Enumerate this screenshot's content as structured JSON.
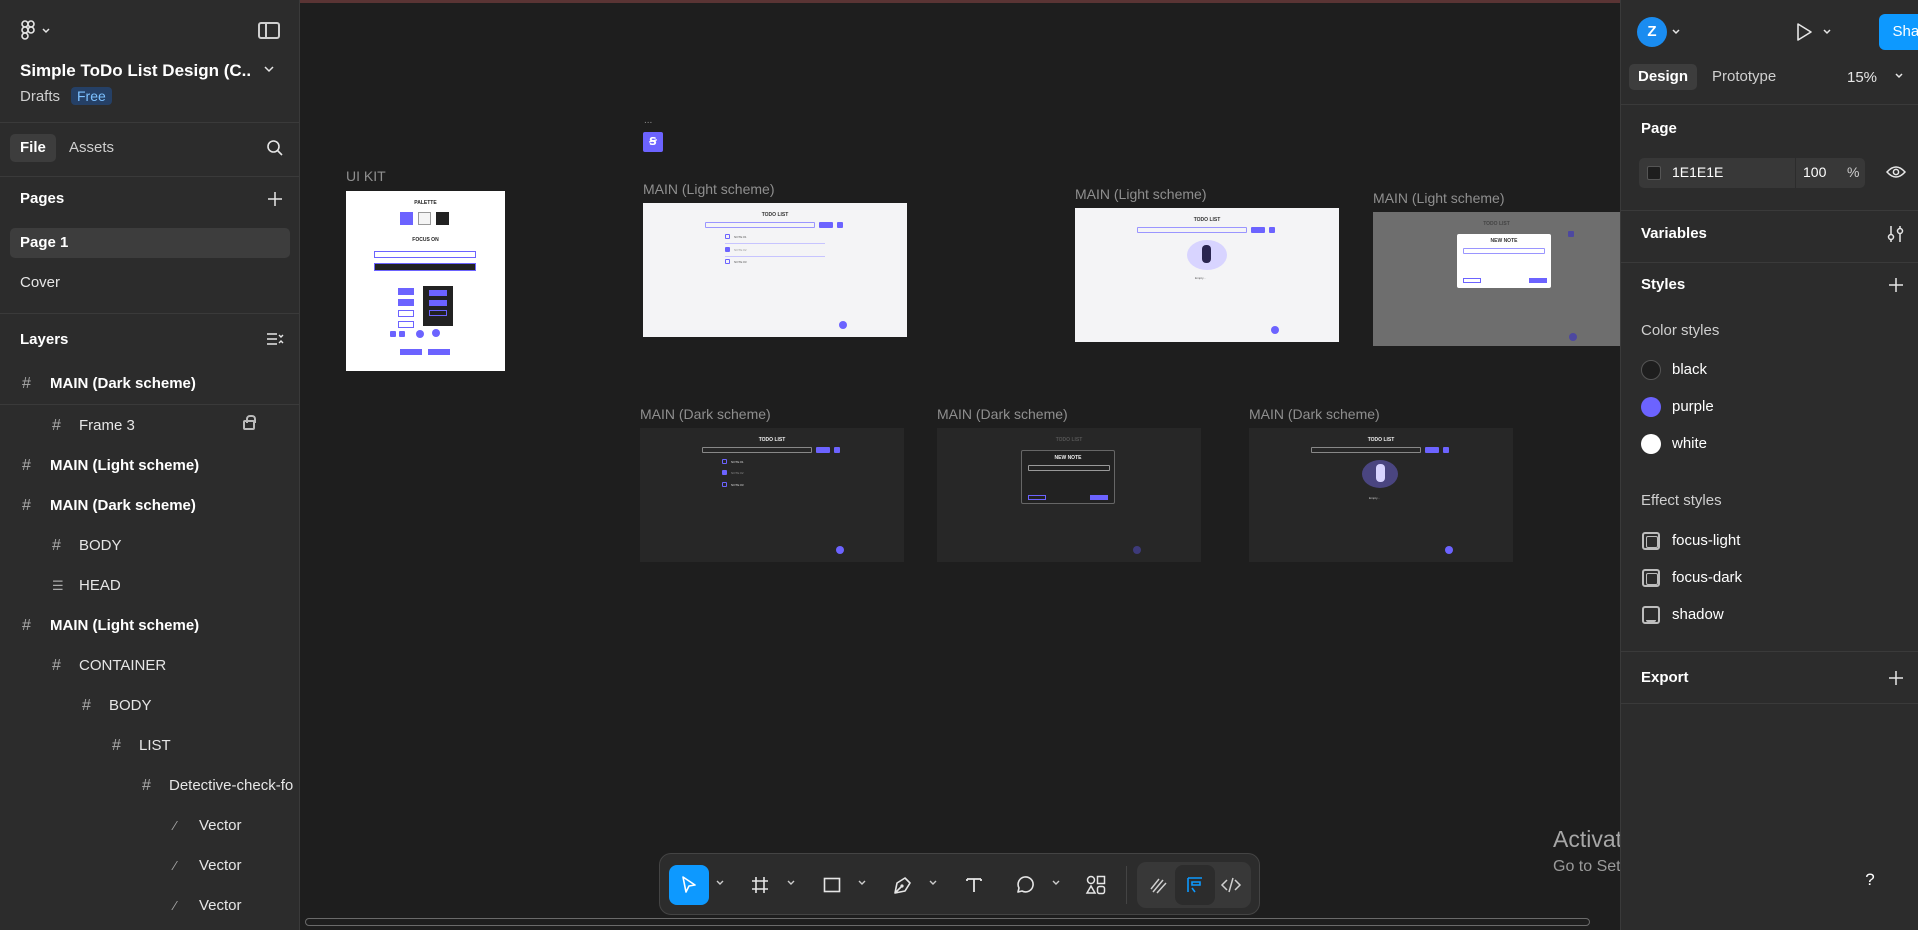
{
  "file": {
    "title": "Simple ToDo List Design (C...",
    "location": "Drafts",
    "plan_badge": "Free"
  },
  "left_tabs": {
    "file": "File",
    "assets": "Assets"
  },
  "pages": {
    "title": "Pages",
    "items": [
      "Page 1",
      "Cover"
    ],
    "active": "Page 1"
  },
  "layers": {
    "title": "Layers",
    "items": [
      "MAIN (Dark scheme)",
      "Frame 3",
      "MAIN (Light scheme)",
      "MAIN (Dark scheme)",
      "BODY",
      "HEAD",
      "MAIN (Light scheme)",
      "CONTAINER",
      "BODY",
      "LIST",
      "Detective-check-fo",
      "Vector",
      "Vector",
      "Vector"
    ]
  },
  "canvas": {
    "frames": [
      "UI KIT",
      "MAIN (Light scheme)",
      "MAIN (Light scheme)",
      "MAIN (Light scheme)",
      "MAIN (Dark scheme)",
      "MAIN (Dark scheme)",
      "MAIN (Dark scheme)"
    ],
    "selection_dots": "...",
    "ui_kit": {
      "palette": "PALETTE",
      "focus_on": "FOCUS ON"
    },
    "todo_title": "TODO LIST",
    "new_note": "NEW NOTE",
    "notes": [
      "NOTE #1",
      "NOTE #2",
      "NOTE #3"
    ],
    "empty_text": "Empty..."
  },
  "right_panel": {
    "avatar_initial": "Z",
    "share": "Share",
    "tabs": {
      "design": "Design",
      "prototype": "Prototype"
    },
    "zoom": "15%",
    "page_section": "Page",
    "page_color": "1E1E1E",
    "page_opacity": "100",
    "percent": "%",
    "variables": "Variables",
    "styles": "Styles",
    "color_styles_title": "Color styles",
    "color_styles": [
      {
        "name": "black",
        "color": "#1e1e1e"
      },
      {
        "name": "purple",
        "color": "#6c63ff"
      },
      {
        "name": "white",
        "color": "#ffffff"
      }
    ],
    "effect_styles_title": "Effect styles",
    "effect_styles": [
      "focus-light",
      "focus-dark",
      "shadow"
    ],
    "export": "Export"
  },
  "toolbar": {
    "tools": [
      "move-tool",
      "frame-tool",
      "shape-tool",
      "pen-tool",
      "text-tool",
      "comment-tool",
      "actions-tool",
      "draw-mode",
      "design-mode",
      "dev-mode"
    ],
    "active_tool": "move-tool"
  },
  "os_watermark": {
    "line1": "Activate Windows",
    "line2": "Go to Settings to activate Windows."
  },
  "help": "?"
}
